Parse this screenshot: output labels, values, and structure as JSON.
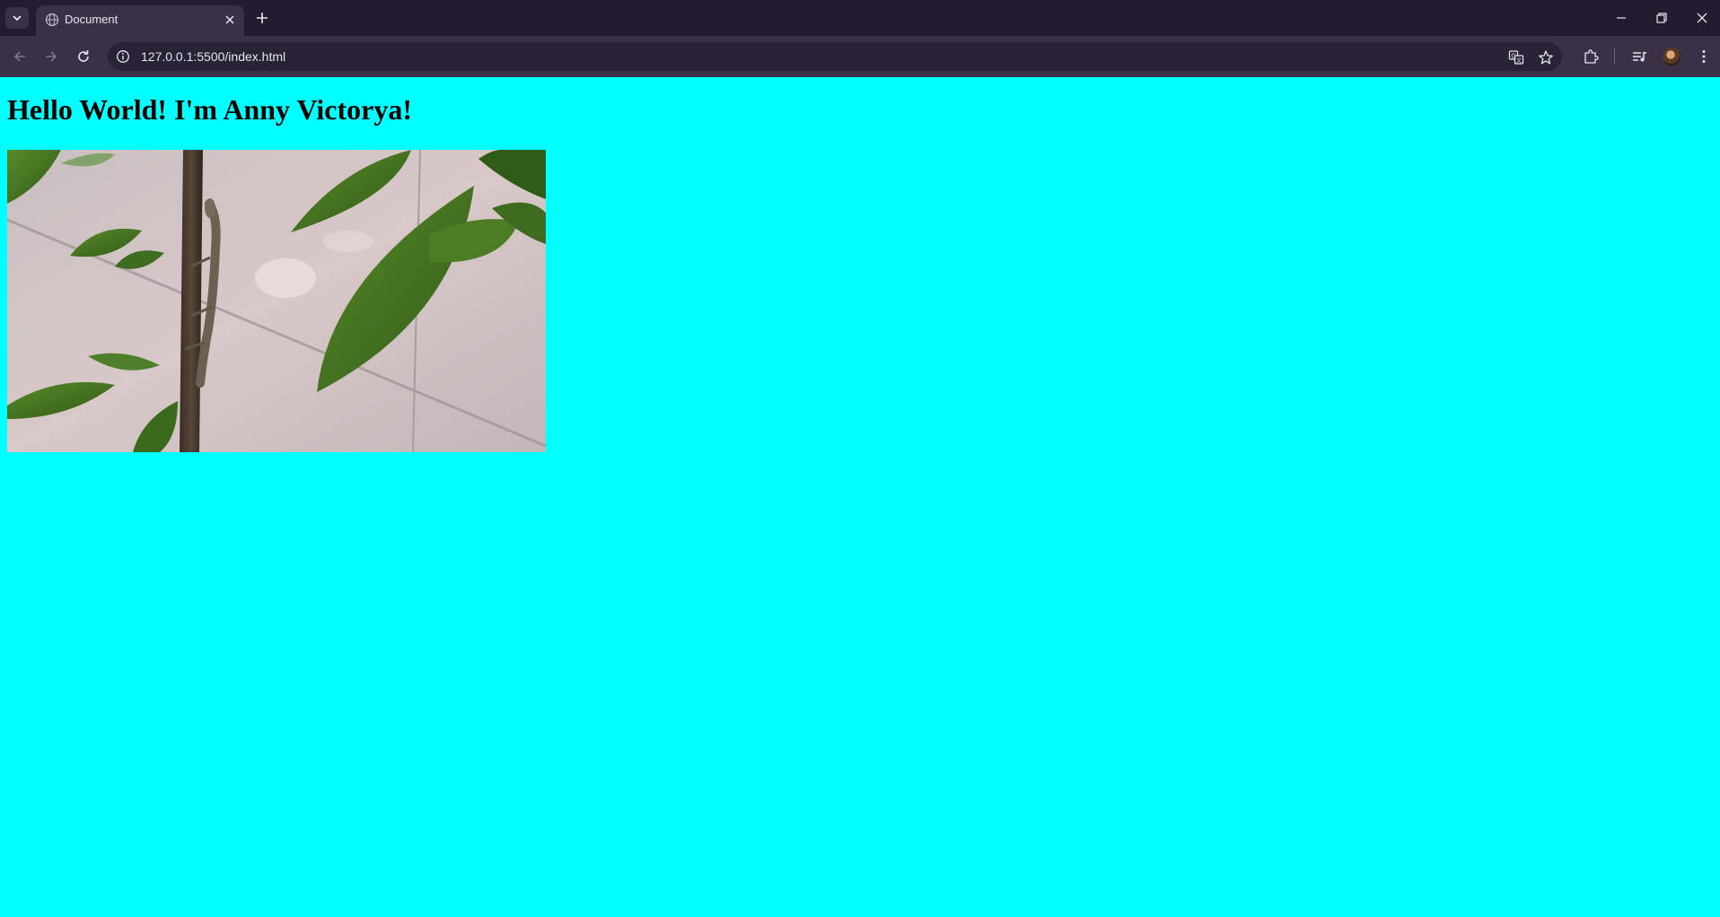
{
  "browser": {
    "tab": {
      "title": "Document"
    },
    "address_bar": {
      "url": "127.0.0.1:5500/index.html"
    },
    "icons": {
      "tab_search": "chevron-down-icon",
      "favicon": "globe-icon",
      "tab_close": "close-icon",
      "new_tab": "plus-icon",
      "back": "arrow-left-icon",
      "forward": "arrow-right-icon",
      "reload": "reload-icon",
      "site_info": "info-icon",
      "translate": "translate-icon",
      "bookmark": "star-icon",
      "extensions": "puzzle-icon",
      "media": "media-controls-icon",
      "menu": "kebab-menu-icon",
      "minimize": "minimize-icon",
      "restore": "restore-icon",
      "close_window": "close-icon"
    }
  },
  "page": {
    "heading": "Hello World! I'm Anny Victorya!",
    "background_color": "#00ffff",
    "image": {
      "subject": "lizard-on-branch-photo"
    }
  },
  "colors": {
    "titlebar": "#231c30",
    "toolbar": "#3a3148",
    "omnibox": "#2a2236"
  }
}
